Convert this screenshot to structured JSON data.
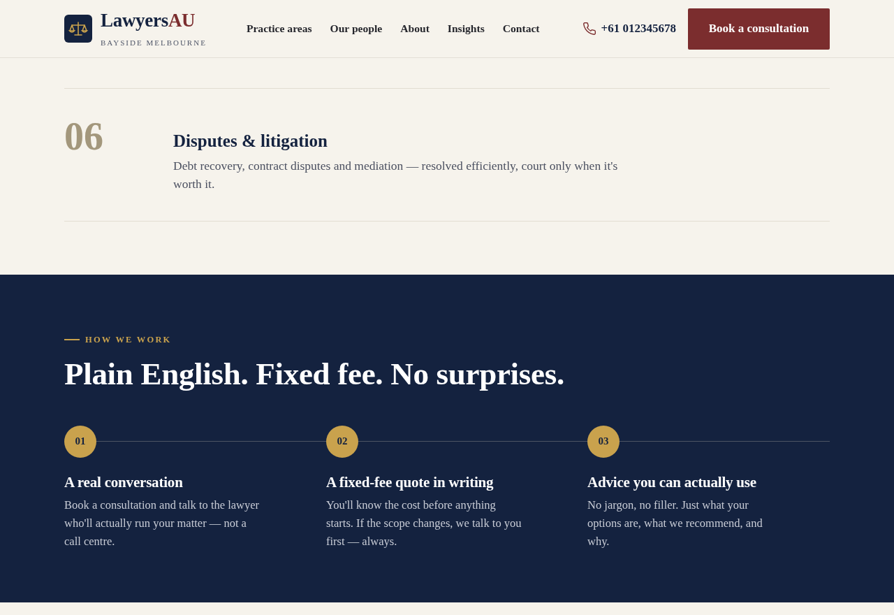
{
  "header": {
    "brand": {
      "name": "Lawyers",
      "accent": "AU",
      "tagline": "BAYSIDE MELBOURNE"
    },
    "nav": [
      "Practice areas",
      "Our people",
      "About",
      "Insights",
      "Contact"
    ],
    "phone": "+61 012345678",
    "cta": "Book a consultation"
  },
  "practice_areas": [
    {
      "number": "06",
      "title": "Disputes & litigation",
      "description": "Debt recovery, contract disputes and mediation — resolved efficiently, court only when it's worth it."
    }
  ],
  "how_we_work": {
    "eyebrow": "HOW WE WORK",
    "heading": "Plain English. Fixed fee. No surprises.",
    "steps": [
      {
        "number": "01",
        "title": "A real conversation",
        "description": "Book a consultation and talk to the lawyer who'll actually run your matter — not a call centre."
      },
      {
        "number": "02",
        "title": "A fixed-fee quote in writing",
        "description": "You'll know the cost before anything starts. If the scope changes, we talk to you first — always."
      },
      {
        "number": "03",
        "title": "Advice you can actually use",
        "description": "No jargon, no filler. Just what your options are, what we recommend, and why."
      }
    ]
  }
}
